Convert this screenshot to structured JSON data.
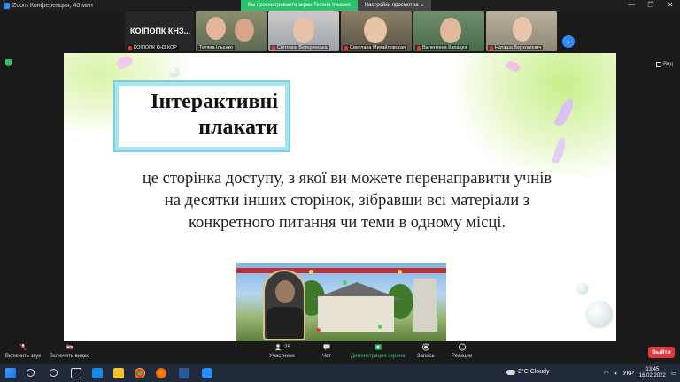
{
  "window": {
    "title": "Zoom Конференция, 40 мин",
    "viewing_banner": "Вы просматриваете экран Тетяна Ільєнко",
    "view_options": "Настройки просмотра ⌄",
    "controls": [
      "—",
      "❐",
      "✕"
    ]
  },
  "participants": {
    "first_tile_big": "КОІПОПК КНЗ...",
    "first_tile_name": "КОІПОПК КНЗ КОР",
    "tiles": [
      {
        "name": "Тетяна Ільєнко",
        "muted": false
      },
      {
        "name": "Світлана Ветерянська",
        "muted": true
      },
      {
        "name": "Светлана Михайловская",
        "muted": true
      },
      {
        "name": "Валентина Капацюк",
        "muted": true
      },
      {
        "name": "Наташа Верхолонич",
        "muted": true
      }
    ]
  },
  "view_button": "Вид",
  "slide": {
    "heading_line1": "Інтерактивні",
    "heading_line2": "плакати",
    "body": "це сторінка доступу, з якої ви можете перенаправити учнів на десятки інших сторінок, зібравши всі матеріали з конкретного питання чи теми в одному місці."
  },
  "toolbar": {
    "unmute": "Включить звук",
    "start_video": "Включить видео",
    "participants": "Участники",
    "participants_count": "25",
    "chat": "Чат",
    "share_screen": "Демонстрация экрана",
    "record": "Запись",
    "reactions": "Реакции",
    "leave": "Выйти"
  },
  "taskbar": {
    "weather": "2°C  Cloudy",
    "language": "УКР",
    "time": "13:45",
    "date": "16.02.2022"
  },
  "colors": {
    "share_green": "#29c26a",
    "leave_red": "#e0383e",
    "zoom_blue": "#2d8cff",
    "heading_border": "#a6e6ef"
  }
}
